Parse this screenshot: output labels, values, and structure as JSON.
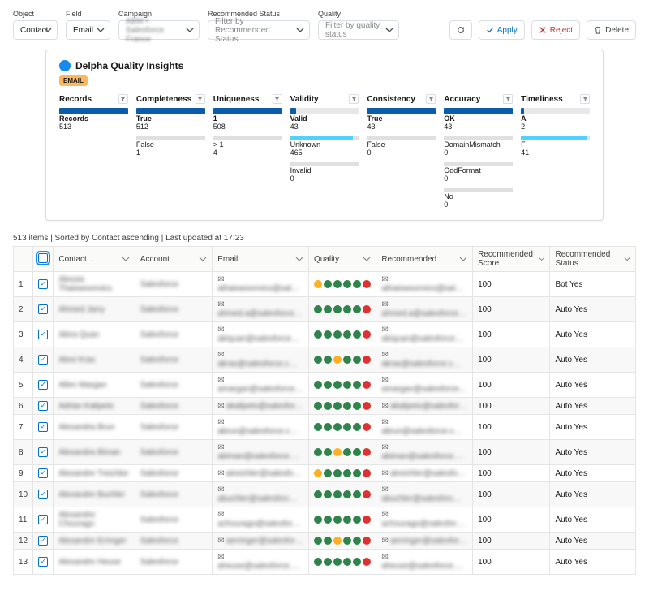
{
  "filters": {
    "object": {
      "label": "Object",
      "value": "Contact"
    },
    "field": {
      "label": "Field",
      "value": "Email"
    },
    "campaign": {
      "label": "Campaign",
      "value": "ABM • Salesforce France"
    },
    "recStatus": {
      "label": "Recommended Status",
      "placeholder": "Filter by Recommended Status"
    },
    "quality": {
      "label": "Quality",
      "placeholder": "Filter by quality status"
    }
  },
  "actions": {
    "apply": "Apply",
    "reject": "Reject",
    "delete": "Delete"
  },
  "card": {
    "title": "Delpha Quality Insights",
    "field": "EMAIL",
    "metrics": [
      {
        "name": "Records",
        "main": {
          "label": "Records",
          "value": "513"
        }
      },
      {
        "name": "Completeness",
        "main": {
          "label": "True",
          "value": "512"
        },
        "subs": [
          {
            "label": "False",
            "value": "1"
          }
        ]
      },
      {
        "name": "Uniqueness",
        "main": {
          "label": "1",
          "value": "508"
        },
        "subs": [
          {
            "label": "> 1",
            "value": "4"
          }
        ]
      },
      {
        "name": "Validity",
        "main": {
          "label": "Valid",
          "value": "43",
          "fill": 0.09
        },
        "subs": [
          {
            "label": "Unknown",
            "value": "465",
            "fill": 0.91
          },
          {
            "label": "Invalid",
            "value": "0"
          }
        ]
      },
      {
        "name": "Consistency",
        "main": {
          "label": "True",
          "value": "43"
        },
        "subs": [
          {
            "label": "False",
            "value": "0"
          }
        ]
      },
      {
        "name": "Accuracy",
        "main": {
          "label": "OK",
          "value": "43"
        },
        "subs": [
          {
            "label": "DomainMismatch",
            "value": "0"
          },
          {
            "label": "OddFormat",
            "value": "0"
          },
          {
            "label": "No",
            "value": "0"
          }
        ]
      },
      {
        "name": "Timeliness",
        "main": {
          "label": "A",
          "value": "2",
          "fill": 0.05
        },
        "subs": [
          {
            "label": "F",
            "value": "41",
            "fill": 0.95
          }
        ]
      }
    ]
  },
  "table": {
    "meta": "513 items | Sorted by Contact ascending | Last updated at 17:23",
    "cols": {
      "contact": "Contact",
      "account": "Account",
      "email": "Email",
      "quality": "Quality",
      "recommended": "Recommended",
      "recScore": "Recommended Score",
      "recStatus": "Recommended Status"
    },
    "rows": [
      {
        "n": "1",
        "contact": "Alexsis Thaiswoonvics",
        "account": "Salesforce",
        "email": "athaiswoonvics@sal…",
        "dots": [
          "y",
          "g",
          "g",
          "g",
          "g",
          "r"
        ],
        "rec": "athaiswoonvics@sal…",
        "score": "100",
        "status": "Bot Yes"
      },
      {
        "n": "2",
        "contact": "Ahmed Jarry",
        "account": "Salesforce",
        "email": "ahmed.a@salesforce…",
        "dots": [
          "g",
          "g",
          "g",
          "g",
          "g",
          "r"
        ],
        "rec": "ahmed.a@salesforce…",
        "score": "100",
        "status": "Auto Yes"
      },
      {
        "n": "3",
        "contact": "Akira Quan",
        "account": "Salesforce",
        "email": "akiquan@salesforce…",
        "dots": [
          "g",
          "g",
          "g",
          "g",
          "g",
          "r"
        ],
        "rec": "akiquan@salesforce…",
        "score": "100",
        "status": "Auto Yes"
      },
      {
        "n": "4",
        "contact": "Alexi Kras",
        "account": "Salesforce",
        "email": "akras@salesforce.c…",
        "dots": [
          "g",
          "g",
          "y",
          "g",
          "g",
          "r"
        ],
        "rec": "akras@salesforce.c…",
        "score": "100",
        "status": "Auto Yes"
      },
      {
        "n": "5",
        "contact": "Allen Margan",
        "account": "Salesforce",
        "email": "amargan@salesforce…",
        "dots": [
          "g",
          "g",
          "g",
          "g",
          "g",
          "r"
        ],
        "rec": "amargan@salesforce…",
        "score": "100",
        "status": "Auto Yes"
      },
      {
        "n": "6",
        "contact": "Adrian Kalipeto",
        "account": "Salesforce",
        "email": "akalipeto@salesfor…",
        "dots": [
          "g",
          "g",
          "g",
          "g",
          "g",
          "r"
        ],
        "rec": "akalipeto@salesfor…",
        "score": "100",
        "status": "Auto Yes"
      },
      {
        "n": "7",
        "contact": "Alexandra Brun",
        "account": "Salesforce",
        "email": "abrun@salesforce.c…",
        "dots": [
          "g",
          "g",
          "g",
          "g",
          "g",
          "r"
        ],
        "rec": "abrun@salesforce.c…",
        "score": "100",
        "status": "Auto Yes"
      },
      {
        "n": "8",
        "contact": "Alexandra Biman",
        "account": "Salesforce",
        "email": "abiman@salesforce.…",
        "dots": [
          "g",
          "g",
          "y",
          "g",
          "g",
          "r"
        ],
        "rec": "abiman@salesforce.…",
        "score": "100",
        "status": "Auto Yes"
      },
      {
        "n": "9",
        "contact": "Alexandre Treichler",
        "account": "Salesforce",
        "email": "atreichler@salesfo…",
        "dots": [
          "y",
          "g",
          "g",
          "g",
          "g",
          "r"
        ],
        "rec": "atreichler@salesfo…",
        "score": "100",
        "status": "Auto Yes"
      },
      {
        "n": "10",
        "contact": "Alexandre Buchler",
        "account": "Salesforce",
        "email": "abuchler@salesforc…",
        "dots": [
          "g",
          "g",
          "g",
          "g",
          "g",
          "r"
        ],
        "rec": "abuchler@salesforc…",
        "score": "100",
        "status": "Auto Yes"
      },
      {
        "n": "11",
        "contact": "Alexandre Chourago",
        "account": "Salesforce",
        "email": "achourago@salesfor…",
        "dots": [
          "g",
          "g",
          "g",
          "g",
          "g",
          "r"
        ],
        "rec": "achourago@salesfor…",
        "score": "100",
        "status": "Auto Yes"
      },
      {
        "n": "12",
        "contact": "Alexandre Erringer",
        "account": "Salesforce",
        "email": "aerringer@salesfor…",
        "dots": [
          "g",
          "g",
          "y",
          "g",
          "g",
          "r"
        ],
        "rec": "aerringer@salesfor…",
        "score": "100",
        "status": "Auto Yes"
      },
      {
        "n": "13",
        "contact": "Alexandre Heuse",
        "account": "Salesforce",
        "email": "aheuse@salesforce.…",
        "dots": [
          "g",
          "g",
          "g",
          "g",
          "g",
          "r"
        ],
        "rec": "aheuse@salesforce.…",
        "score": "100",
        "status": "Auto Yes"
      }
    ]
  }
}
